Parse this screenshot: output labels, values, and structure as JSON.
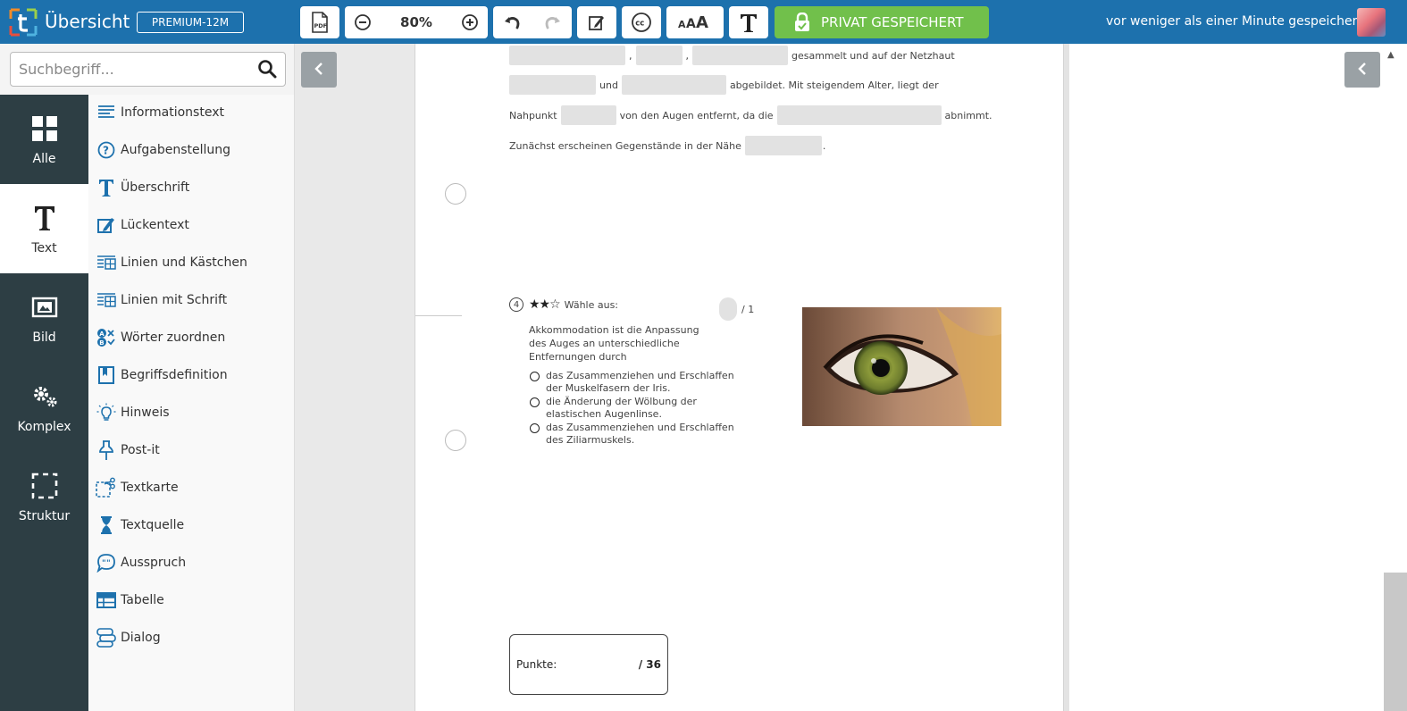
{
  "topbar": {
    "title": "Übersicht",
    "plan": "PREMIUM-12M",
    "zoom": "80%",
    "save_label": "PRIVAT GESPEICHERT",
    "save_status": "vor weniger als einer Minute gespeichert",
    "colors": {
      "bar": "#1d71ad",
      "save": "#71c04b"
    }
  },
  "search": {
    "placeholder": "Suchbegriff..."
  },
  "categories": [
    {
      "label": "Alle",
      "icon": "grid-icon"
    },
    {
      "label": "Text",
      "icon": "text-t-icon",
      "active": true
    },
    {
      "label": "Bild",
      "icon": "image-icon"
    },
    {
      "label": "Komplex",
      "icon": "gears-icon"
    },
    {
      "label": "Struktur",
      "icon": "dashed-square-icon"
    }
  ],
  "blocks": [
    {
      "label": "Informationstext",
      "icon": "lines-icon"
    },
    {
      "label": "Aufgabenstellung",
      "icon": "question-icon"
    },
    {
      "label": "Überschrift",
      "icon": "heading-icon"
    },
    {
      "label": "Lückentext",
      "icon": "edit-icon"
    },
    {
      "label": "Linien und Kästchen",
      "icon": "lines-boxes-icon"
    },
    {
      "label": "Linien mit Schrift",
      "icon": "lines-text-icon"
    },
    {
      "label": "Wörter zuordnen",
      "icon": "match-words-icon"
    },
    {
      "label": "Begriffsdefinition",
      "icon": "bookmark-icon"
    },
    {
      "label": "Hinweis",
      "icon": "bulb-icon"
    },
    {
      "label": "Post-it",
      "icon": "pin-icon"
    },
    {
      "label": "Textkarte",
      "icon": "scissors-icon"
    },
    {
      "label": "Textquelle",
      "icon": "hourglass-icon"
    },
    {
      "label": "Ausspruch",
      "icon": "speech-icon"
    },
    {
      "label": "Tabelle",
      "icon": "table-icon"
    },
    {
      "label": "Dialog",
      "icon": "dialog-icon"
    }
  ],
  "worksheet": {
    "cloze": {
      "sep1": ",",
      "sep2": ",",
      "line1_end": "gesammelt und auf der Netzhaut",
      "line2_mid": "und",
      "line2_end": "abgebildet. Mit steigendem Alter, liegt der",
      "line3_start": "Nahpunkt",
      "line3_mid": "von den Augen entfernt, da die",
      "line3_end": "abnimmt.",
      "line4_start": "Zunächst erscheinen Gegenstände in der Nähe",
      "line4_end": "."
    },
    "task": {
      "number": "4",
      "stars": "★★☆",
      "instruction": "Wähle aus:",
      "max_points": "/ 1",
      "question": "Akkommodation ist die Anpassung des Auges an unterschiedliche Entfernungen durch",
      "options": [
        "das Zusammenziehen und Erschlaffen der Muskelfasern der Iris.",
        "die Änderung der Wölbung der elastischen Augenlinse.",
        "das Zusammenziehen und Erschlaffen des Ziliarmuskels."
      ]
    },
    "points_label": "Punkte:",
    "points_total": "/ 36"
  }
}
